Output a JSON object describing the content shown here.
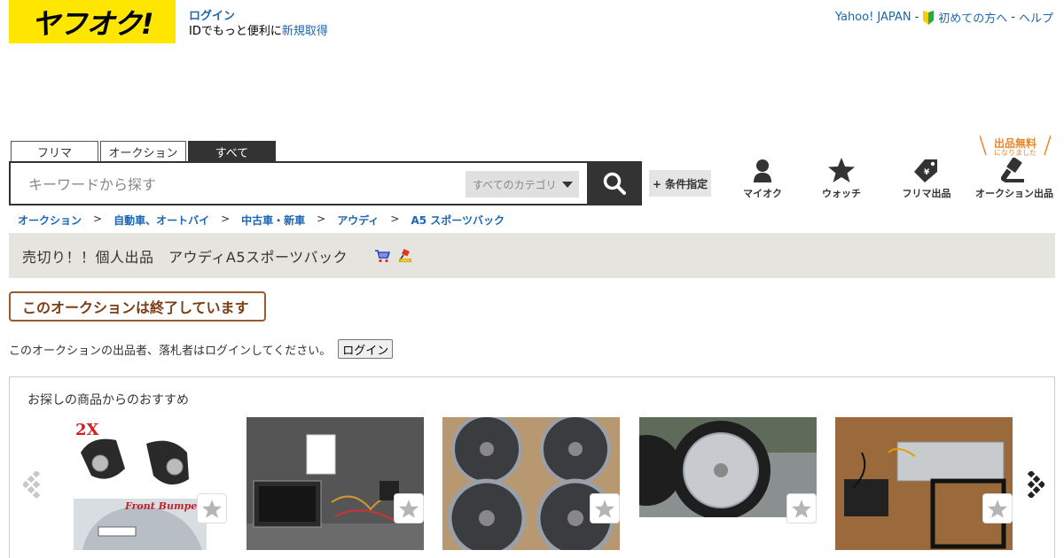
{
  "header": {
    "logo_text": "ヤフオク!",
    "login_label": "ログイン",
    "login_sub_prefix": "IDでもっと便利に",
    "signup_link": "新規取得",
    "yahoo_japan": "Yahoo! JAPAN",
    "separator": "-",
    "first_time": "初めての方へ",
    "help": "ヘルプ"
  },
  "search": {
    "tabs": [
      "フリマ",
      "オークション",
      "すべて"
    ],
    "active_tab": "すべて",
    "placeholder": "キーワードから探す",
    "category_value": "すべてのカテゴリ",
    "condition_button": "+ 条件指定"
  },
  "nav": {
    "my_auction": "マイオク",
    "watch": "ウォッチ",
    "flea_listing": "フリマ出品",
    "auction_listing": "オークション出品",
    "free_listing_main": "出品無料",
    "free_listing_sub": "になりました"
  },
  "breadcrumb": [
    "オークション",
    "自動車、オートバイ",
    "中古車・新車",
    "アウディ",
    "A5 スポーツバック"
  ],
  "breadcrumb_sep": ">",
  "item": {
    "title": "売切り！！個人出品　アウディA5スポーツバック",
    "status": "このオークションは終了しています",
    "login_note": "このオークションの出品者、落札者はログインしてください。",
    "login_button": "ログイン"
  },
  "recommendation": {
    "title": "お探しの商品からのおすすめ",
    "overlay_texts": [
      "2X",
      "Front Bumper Gril"
    ]
  },
  "colors": {
    "brand_yellow": "#ffe600",
    "link_blue": "#1a66b3",
    "ended_border": "#9b5b2e",
    "free_orange": "#e8862c"
  }
}
